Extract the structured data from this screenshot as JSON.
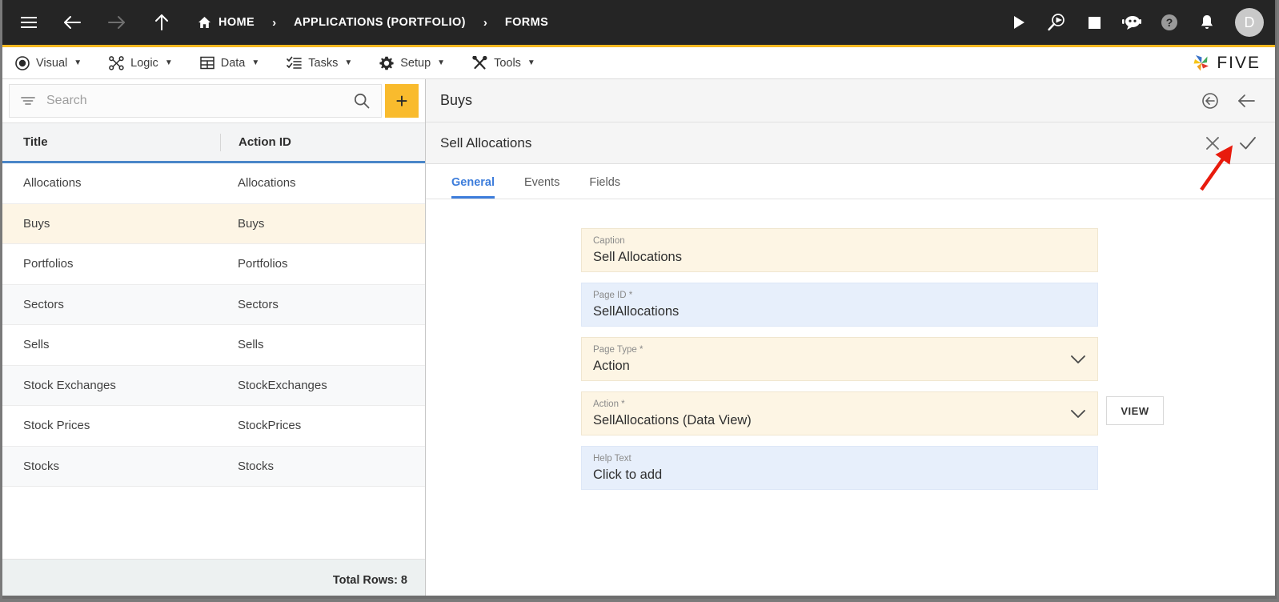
{
  "topbar": {
    "menu_icon": "hamburger-icon",
    "back_icon": "back-arrow-icon",
    "forward_icon": "forward-arrow-icon",
    "up_icon": "up-arrow-icon",
    "breadcrumbs": [
      {
        "label": "HOME",
        "icon": "home-icon"
      },
      {
        "label": "APPLICATIONS (PORTFOLIO)",
        "icon": ""
      },
      {
        "label": "FORMS",
        "icon": ""
      }
    ],
    "separator": "›",
    "actions": [
      {
        "name": "run-icon",
        "title": "Run"
      },
      {
        "name": "debug-icon",
        "title": "Debug"
      },
      {
        "name": "stop-icon",
        "title": "Stop"
      },
      {
        "name": "chat-bot-icon",
        "title": "Assistant"
      },
      {
        "name": "help-icon",
        "title": "Help"
      },
      {
        "name": "notifications-bell-icon",
        "title": "Notifications"
      }
    ],
    "avatar_initial": "D"
  },
  "menubar": {
    "items": [
      {
        "label": "Visual",
        "icon": "eye-icon"
      },
      {
        "label": "Logic",
        "icon": "logic-nodes-icon"
      },
      {
        "label": "Data",
        "icon": "grid-table-icon"
      },
      {
        "label": "Tasks",
        "icon": "checklist-icon"
      },
      {
        "label": "Setup",
        "icon": "gear-icon"
      },
      {
        "label": "Tools",
        "icon": "tools-icon"
      }
    ],
    "caret": "▼",
    "brand": "FIVE"
  },
  "accent_colors": {
    "brand_yellow": "#f7b820",
    "add_button_yellow": "#f9bb2d",
    "header_underline_blue": "#4a86c8",
    "active_tab_blue": "#3d7ddb",
    "modified_field_cream": "#fdf5e4",
    "readonly_field_blue": "#e7effb",
    "selected_row_cream": "#fdf5e5",
    "annotation_red": "#e81b0d",
    "topbar_dark": "#252525"
  },
  "left_panel": {
    "search": {
      "placeholder": "Search",
      "value": "",
      "filter_icon": "filter-icon",
      "search_icon": "search-icon"
    },
    "add_button_label": "+",
    "columns": [
      "Title",
      "Action ID"
    ],
    "rows": [
      {
        "title": "Allocations",
        "action_id": "Allocations",
        "selected": false
      },
      {
        "title": "Buys",
        "action_id": "Buys",
        "selected": true
      },
      {
        "title": "Portfolios",
        "action_id": "Portfolios",
        "selected": false
      },
      {
        "title": "Sectors",
        "action_id": "Sectors",
        "selected": false
      },
      {
        "title": "Sells",
        "action_id": "Sells",
        "selected": false
      },
      {
        "title": "Stock Exchanges",
        "action_id": "StockExchanges",
        "selected": false
      },
      {
        "title": "Stock Prices",
        "action_id": "StockPrices",
        "selected": false
      },
      {
        "title": "Stocks",
        "action_id": "Stocks",
        "selected": false
      }
    ],
    "footer_text": "Total Rows: 8"
  },
  "right_panel": {
    "header": {
      "title": "Buys",
      "revert_icon": "revert-circle-arrow-icon",
      "back_icon": "back-arrow-icon"
    },
    "subheader": {
      "title": "Sell Allocations",
      "cancel_icon": "close-x-icon",
      "confirm_icon": "check-icon"
    },
    "tabs": [
      {
        "label": "General",
        "active": true
      },
      {
        "label": "Events",
        "active": false
      },
      {
        "label": "Fields",
        "active": false
      }
    ],
    "fields": [
      {
        "label": "Caption",
        "value": "Sell Allocations",
        "style": "cream",
        "dropdown": false,
        "button": ""
      },
      {
        "label": "Page ID *",
        "value": "SellAllocations",
        "style": "blue",
        "dropdown": false,
        "button": ""
      },
      {
        "label": "Page Type *",
        "value": "Action",
        "style": "cream",
        "dropdown": true,
        "button": ""
      },
      {
        "label": "Action *",
        "value": "SellAllocations (Data View)",
        "style": "cream",
        "dropdown": true,
        "button": "VIEW"
      },
      {
        "label": "Help Text",
        "value": "Click to add",
        "style": "blue",
        "dropdown": false,
        "button": ""
      }
    ]
  },
  "annotation": {
    "type": "red-arrow",
    "points_to": "confirm-check-icon"
  }
}
